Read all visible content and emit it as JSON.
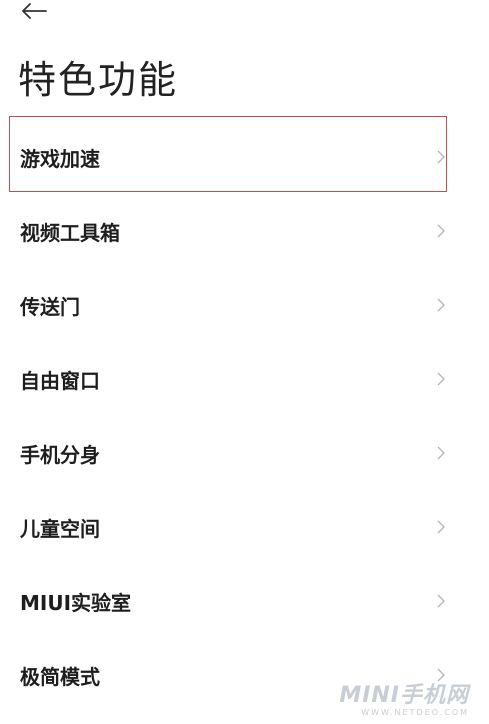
{
  "header": {
    "back_icon": "arrow-left-icon",
    "title": "特色功能"
  },
  "list": {
    "items": [
      {
        "label": "游戏加速",
        "highlighted": true
      },
      {
        "label": "视频工具箱"
      },
      {
        "label": "传送门"
      },
      {
        "label": "自由窗口"
      },
      {
        "label": "手机分身"
      },
      {
        "label": "儿童空间"
      },
      {
        "label": "MIUI实验室"
      },
      {
        "label": "极简模式"
      }
    ],
    "chevron_icon": "chevron-right-icon",
    "highlight_color": "#c0504d"
  },
  "watermark": {
    "main": "MINI手机网",
    "sub": "WWW.NETDEO.COM"
  }
}
